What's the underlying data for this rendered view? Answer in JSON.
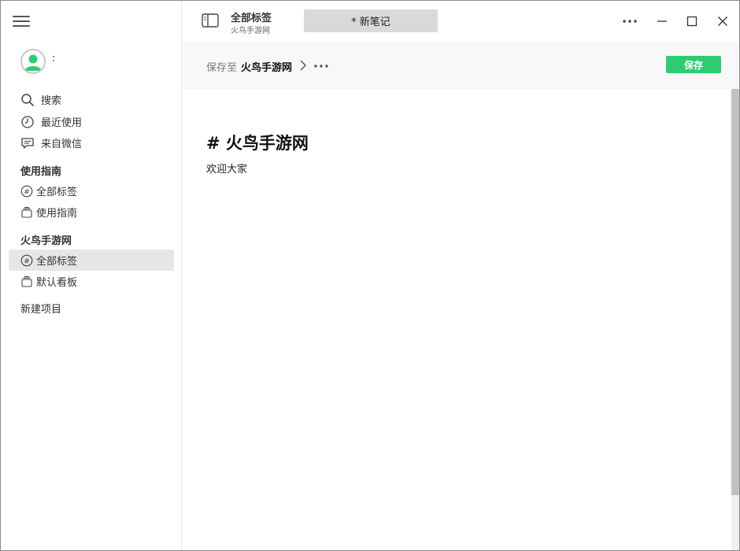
{
  "user": {
    "name": ":"
  },
  "sidebar": {
    "nav": [
      {
        "label": "搜索",
        "icon": "search-icon"
      },
      {
        "label": "最近使用",
        "icon": "clock-icon"
      },
      {
        "label": "来自微信",
        "icon": "chat-icon"
      }
    ],
    "sections": [
      {
        "title": "使用指南",
        "items": [
          {
            "label": "全部标签",
            "icon": "hash-icon"
          },
          {
            "label": "使用指南",
            "icon": "stack-icon"
          }
        ]
      },
      {
        "title": "火鸟手游网",
        "items": [
          {
            "label": "全部标签",
            "icon": "hash-icon"
          },
          {
            "label": "默认看板",
            "icon": "stack-icon"
          }
        ]
      }
    ],
    "new_project": "新建项目"
  },
  "topbar": {
    "title": "全部标签",
    "subtitle": "火鸟手游网",
    "tab_label": "* 新笔记"
  },
  "editor_header": {
    "save_to_label": "保存至",
    "save_to_target": "火鸟手游网",
    "save_button": "保存"
  },
  "document": {
    "heading": "# 火鸟手游网",
    "body": "欢迎大家"
  },
  "colors": {
    "accent": "#2ecc71",
    "active_bg": "#e6e6e6",
    "tab_bg": "#d9d9d9"
  }
}
